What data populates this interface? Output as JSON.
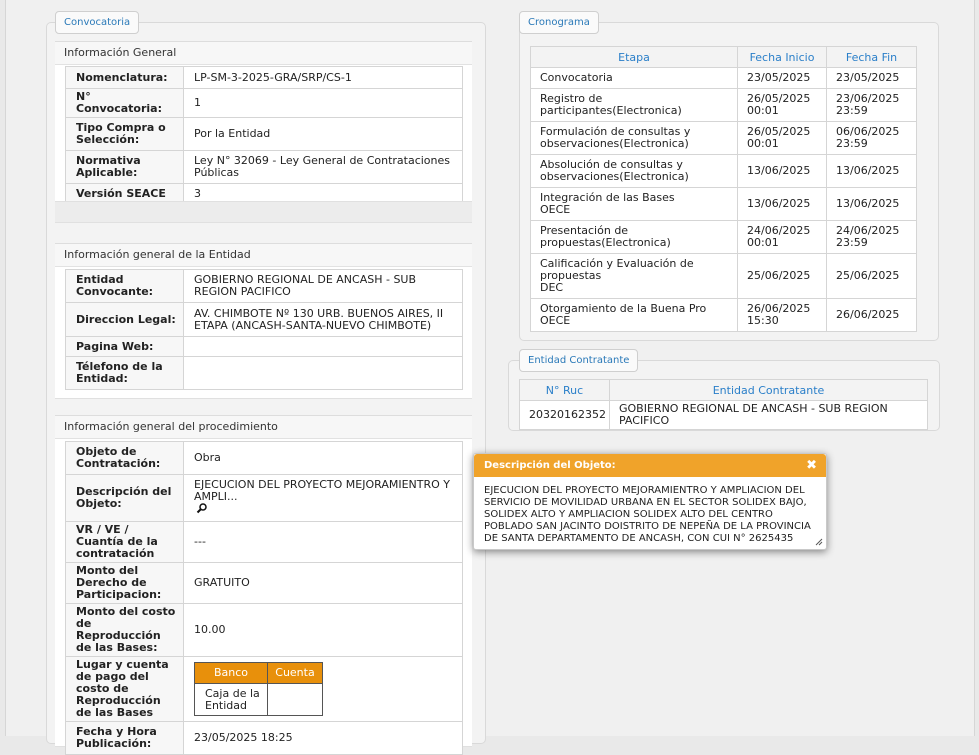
{
  "tabs": {
    "convocatoria": "Convocatoria",
    "cronograma": "Cronograma",
    "entidad_contratante": "Entidad Contratante"
  },
  "info_general": {
    "title": "Información General",
    "rows": [
      {
        "k": "Nomenclatura:",
        "v": "LP-SM-3-2025-GRA/SRP/CS-1"
      },
      {
        "k": "N° Convocatoria:",
        "v": "1"
      },
      {
        "k": "Tipo Compra o Selección:",
        "v": "Por la Entidad"
      },
      {
        "k": "Normativa Aplicable:",
        "v": "Ley N° 32069 - Ley General de Contrataciones Públicas"
      },
      {
        "k": "Versión SEACE",
        "v": "3"
      }
    ]
  },
  "info_entidad": {
    "title": "Información general de la Entidad",
    "rows": [
      {
        "k": "Entidad Convocante:",
        "v": "GOBIERNO REGIONAL DE ANCASH - SUB REGION PACIFICO"
      },
      {
        "k": "Direccion Legal:",
        "v": "AV. CHIMBOTE Nº 130 URB. BUENOS AIRES, II ETAPA (ANCASH-SANTA-NUEVO CHIMBOTE)"
      },
      {
        "k": "Pagina Web:",
        "v": ""
      },
      {
        "k": "Télefono de la Entidad:",
        "v": ""
      }
    ]
  },
  "info_procedimiento": {
    "title": "Información general del procedimiento",
    "objeto_k": "Objeto de Contratación:",
    "objeto_v": "Obra",
    "desc_k": "Descripción del Objeto:",
    "desc_v": "EJECUCION DEL PROYECTO MEJORAMIENTRO Y AMPLI...",
    "vr_k": "VR / VE / Cuantía de la contratación",
    "vr_v": "---",
    "monto_der_k": "Monto del Derecho de Participacion:",
    "monto_der_v": "GRATUITO",
    "monto_costo_k": "Monto del costo de Reproducción de las Bases:",
    "monto_costo_v": "10.00",
    "lugar_k": "Lugar y cuenta de pago del costo de Reproducción de las Bases",
    "banco_header": "Banco",
    "cuenta_header": "Cuenta",
    "banco_value": "Caja de la Entidad",
    "cuenta_value": "",
    "fecha_k": "Fecha y Hora Publicación:",
    "fecha_v": "23/05/2025 18:25"
  },
  "cronograma": {
    "headers": [
      "Etapa",
      "Fecha Inicio",
      "Fecha Fin"
    ],
    "rows": [
      {
        "etapa": "Convocatoria",
        "sub": "",
        "inicio": "23/05/2025",
        "inicio_h": "",
        "fin": "23/05/2025",
        "fin_h": ""
      },
      {
        "etapa": "Registro de participantes(Electronica)",
        "sub": "",
        "inicio": "26/05/2025",
        "inicio_h": "00:01",
        "fin": "23/06/2025",
        "fin_h": "23:59"
      },
      {
        "etapa": "Formulación de consultas y observaciones(Electronica)",
        "sub": "",
        "inicio": "26/05/2025",
        "inicio_h": "00:01",
        "fin": "06/06/2025",
        "fin_h": "23:59"
      },
      {
        "etapa": "Absolución de consultas y observaciones(Electronica)",
        "sub": "",
        "inicio": "13/06/2025",
        "inicio_h": "",
        "fin": "13/06/2025",
        "fin_h": ""
      },
      {
        "etapa": "Integración de las Bases",
        "sub": "OECE",
        "inicio": "13/06/2025",
        "inicio_h": "",
        "fin": "13/06/2025",
        "fin_h": ""
      },
      {
        "etapa": "Presentación de propuestas(Electronica)",
        "sub": "",
        "inicio": "24/06/2025",
        "inicio_h": "00:01",
        "fin": "24/06/2025",
        "fin_h": "23:59"
      },
      {
        "etapa": "Calificación y Evaluación de propuestas",
        "sub": "DEC",
        "inicio": "25/06/2025",
        "inicio_h": "",
        "fin": "25/06/2025",
        "fin_h": ""
      },
      {
        "etapa": "Otorgamiento de la Buena Pro",
        "sub": "OECE",
        "inicio": "26/06/2025",
        "inicio_h": "15:30",
        "fin": "26/06/2025",
        "fin_h": ""
      }
    ]
  },
  "entidad_contratante": {
    "headers": [
      "N° Ruc",
      "Entidad Contratante"
    ],
    "ruc": "20320162352",
    "nombre": "GOBIERNO REGIONAL DE ANCASH - SUB REGION PACIFICO"
  },
  "popup": {
    "title": "Descripción del Objeto:",
    "close": "✖",
    "body": "EJECUCION DEL PROYECTO MEJORAMIENTRO Y AMPLIACION DEL SERVICIO DE MOVILIDAD URBANA EN EL SECTOR SOLIDEX BAJO, SOLIDEX ALTO Y AMPLIACION SOLIDEX ALTO DEL CENTRO POBLADO SAN JACINTO DOISTRITO DE NEPEÑA DE LA PROVINCIA DE SANTA DEPARTAMENTO DE ANCASH, CON CUI N° 2625435"
  },
  "colors": {
    "accent": "#2a7fc9",
    "popup_header": "#f0a32a",
    "bank_header": "#e8900b"
  },
  "icons": {
    "magnifier": "magnifier-icon",
    "close": "close-icon",
    "resize": "resize-grip-icon"
  }
}
